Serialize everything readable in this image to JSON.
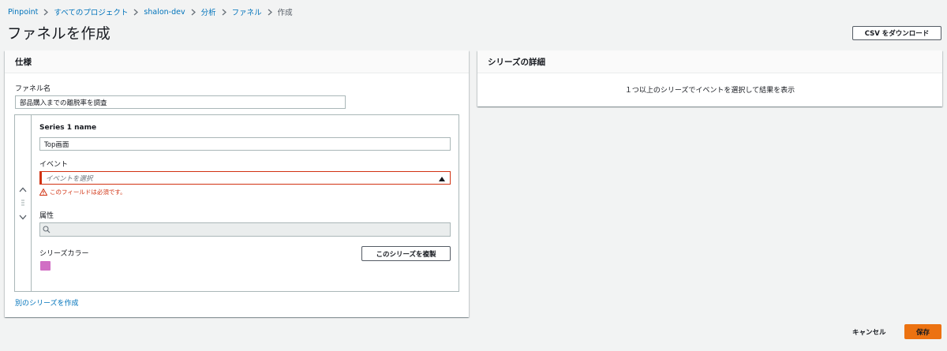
{
  "breadcrumb": {
    "items": [
      "Pinpoint",
      "すべてのプロジェクト",
      "shalon-dev",
      "分析",
      "ファネル"
    ],
    "current": "作成"
  },
  "page": {
    "title": "ファネルを作成"
  },
  "header_actions": {
    "csv_download_label": "CSV をダウンロード"
  },
  "spec_panel": {
    "title": "仕様",
    "funnel_name_label": "ファネル名",
    "funnel_name_value": "部品購入までの離脱率を調査",
    "series": {
      "name_label": "Series 1 name",
      "name_value": "Top画面",
      "event_label": "イベント",
      "event_placeholder": "イベントを選択",
      "event_error": "このフィールドは必須です。",
      "attribute_label": "属性",
      "attribute_placeholder": "",
      "color_label": "シリーズカラー",
      "color_value": "#d16ec4",
      "duplicate_label": "このシリーズを複製"
    },
    "add_series_label": "別のシリーズを作成"
  },
  "detail_panel": {
    "title": "シリーズの詳細",
    "empty_message": "１つ以上のシリーズでイベントを選択して結果を表示"
  },
  "footer": {
    "cancel_label": "キャンセル",
    "save_label": "保存",
    "save_color": "#ec7211"
  },
  "colors": {
    "link": "#0073bb",
    "error": "#d13212",
    "primary": "#ec7211"
  }
}
